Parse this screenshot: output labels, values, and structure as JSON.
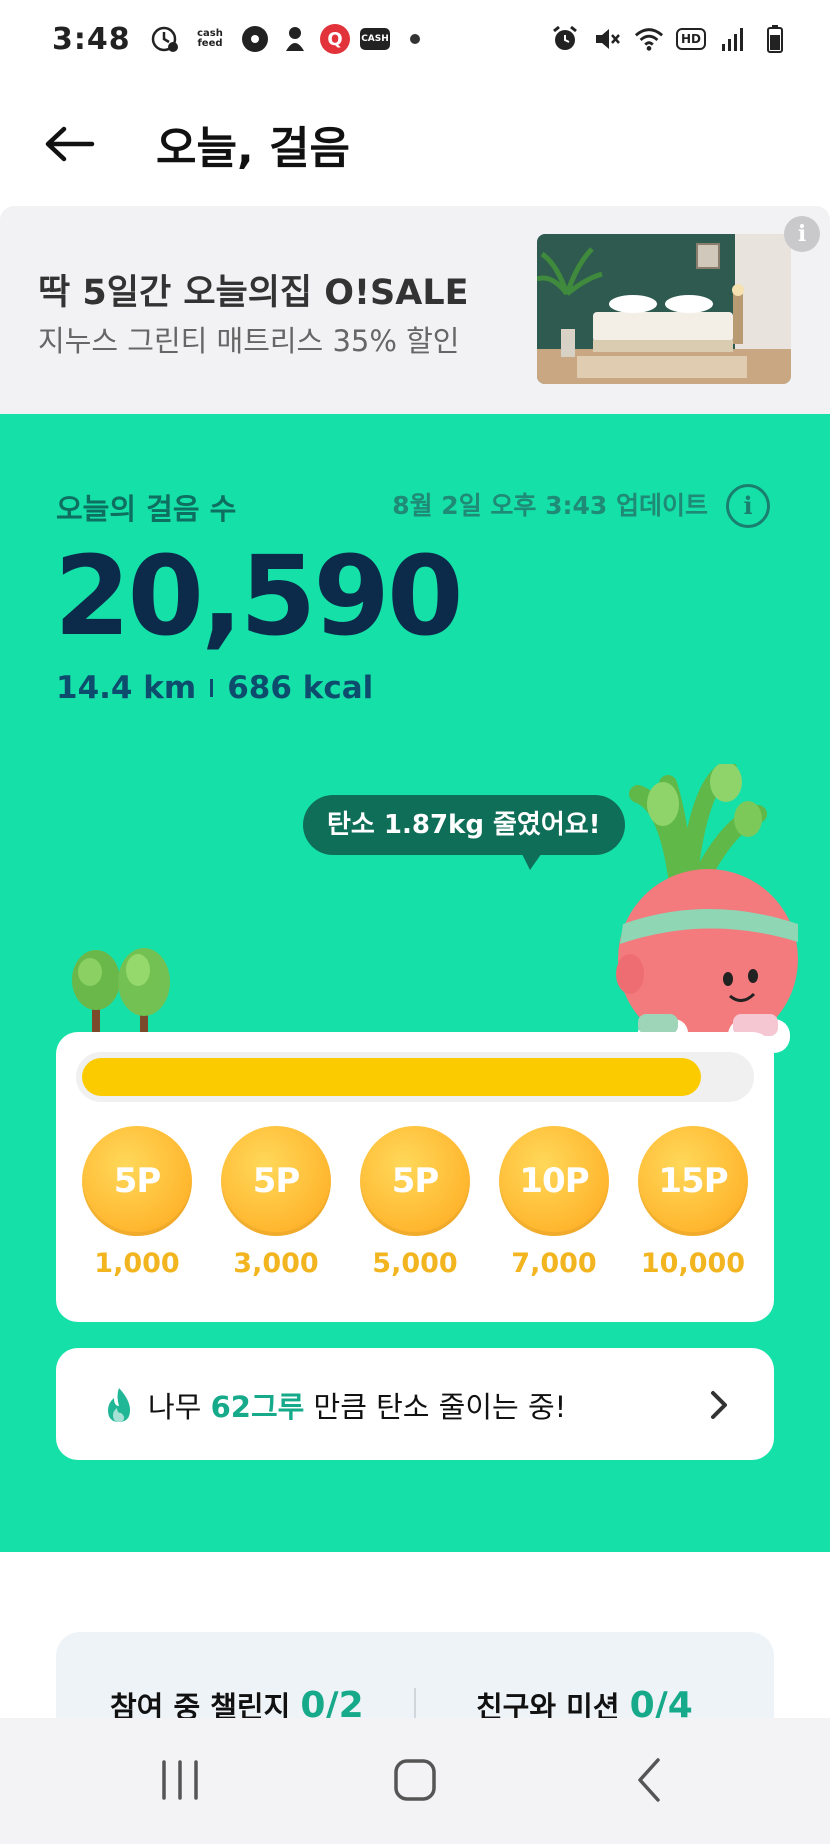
{
  "status_bar": {
    "time": "3:48",
    "left_icons": [
      "clock-badge-icon",
      "cashfeed-icon",
      "gear-badge-icon",
      "mascot-badge-icon",
      "q-app-icon",
      "cash-app-icon",
      "dot-icon"
    ],
    "cashfeed_label": "cash feed",
    "cash_label": "CASH",
    "q_label": "Q",
    "right_icons": [
      "alarm-icon",
      "mute-icon",
      "wifi-icon",
      "hd-icon",
      "signal-icon",
      "battery-icon"
    ],
    "hd_label": "HD"
  },
  "header": {
    "title": "오늘, 걸음",
    "back_icon": "arrow-left-icon"
  },
  "ad_banner": {
    "title": "딱 5일간 오늘의집 O!SALE",
    "subtitle": "지누스 그린티 매트리스 35% 할인",
    "info_label": "i"
  },
  "steps": {
    "label": "오늘의 걸음 수",
    "update_text": "8월 2일 오후 3:43 업데이트",
    "info_label": "i",
    "count": "20,590",
    "distance": "14.4 km",
    "calories": "686 kcal"
  },
  "bubble": {
    "text": "탄소 1.87kg 줄였어요!"
  },
  "progress": {
    "fraction": 0.93,
    "milestones": [
      {
        "reward": "5P",
        "steps": "1,000"
      },
      {
        "reward": "5P",
        "steps": "3,000"
      },
      {
        "reward": "5P",
        "steps": "5,000"
      },
      {
        "reward": "10P",
        "steps": "7,000"
      },
      {
        "reward": "15P",
        "steps": "10,000"
      }
    ]
  },
  "carbon": {
    "prefix": "나무 ",
    "highlight": "62그루",
    "suffix": " 만큼 탄소 줄이는 중!"
  },
  "challenges": {
    "left_label": "참여 중 챌린지 ",
    "left_count": "0/2",
    "right_label": "친구와 미션 ",
    "right_count": "0/4"
  },
  "colors": {
    "green_bg": "#15e0a8",
    "progress_fill": "#fbcb00",
    "coin": "#ffb62e",
    "accent_text": "#16a98a",
    "steps_number": "#0c2a4a"
  }
}
